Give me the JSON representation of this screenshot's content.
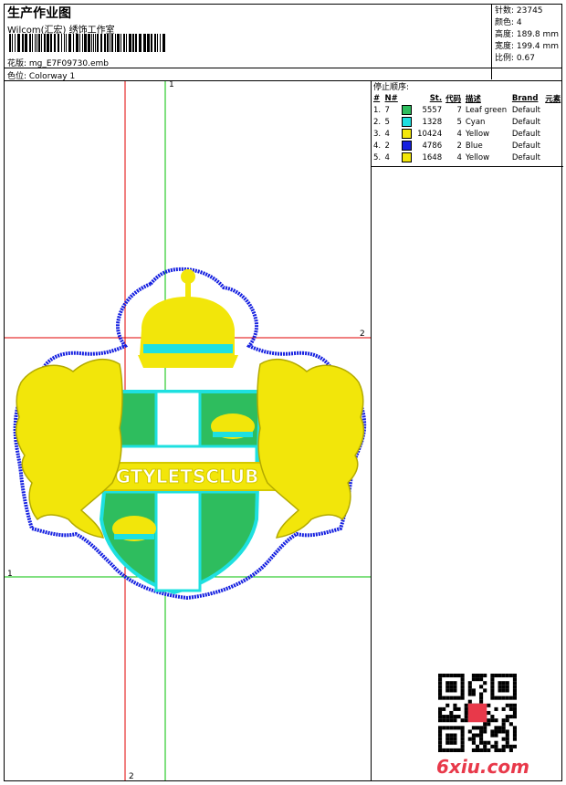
{
  "header": {
    "title": "生产作业图",
    "company": "Wilcom(汇宏) 绣饰工作室",
    "design_line": "花版: mg_E7F09730.emb",
    "colorway_line": "色位: Colorway 1"
  },
  "stats": {
    "stitches": "针数: 23745",
    "colors": "颜色: 4",
    "height": "高度: 189.8 mm",
    "width": "宽度: 199.4 mm",
    "scale": "比例: 0.67"
  },
  "stop_sequence": {
    "title": "停止顺序:",
    "headers": [
      "#",
      "N#",
      "",
      "St.",
      "代码",
      "描述",
      "Brand",
      "元素"
    ],
    "rows": [
      {
        "seq": "1.",
        "n": "7",
        "color": "#2ebd5e",
        "st": "5557",
        "code": "7",
        "desc": "Leaf green",
        "brand": "Default"
      },
      {
        "seq": "2.",
        "n": "5",
        "color": "#1ee0e0",
        "st": "1328",
        "code": "5",
        "desc": "Cyan",
        "brand": "Default"
      },
      {
        "seq": "3.",
        "n": "4",
        "color": "#f2e60a",
        "st": "10424",
        "code": "4",
        "desc": "Yellow",
        "brand": "Default"
      },
      {
        "seq": "4.",
        "n": "2",
        "color": "#1520e0",
        "st": "4786",
        "code": "2",
        "desc": "Blue",
        "brand": "Default"
      },
      {
        "seq": "5.",
        "n": "4",
        "color": "#f2e60a",
        "st": "1648",
        "code": "4",
        "desc": "Yellow",
        "brand": "Default"
      }
    ]
  },
  "guides": {
    "green_label_top": "1",
    "green_label_left": "1",
    "red_label_right": "2",
    "red_label_bottom": "2"
  },
  "design": {
    "banner_text": "GTYLETSCLUB",
    "colors": {
      "blue": "#1520e0",
      "yellow": "#f2e60a",
      "green": "#2ebd5e",
      "cyan": "#1ee0e0"
    }
  },
  "watermark": "6xiu.com"
}
